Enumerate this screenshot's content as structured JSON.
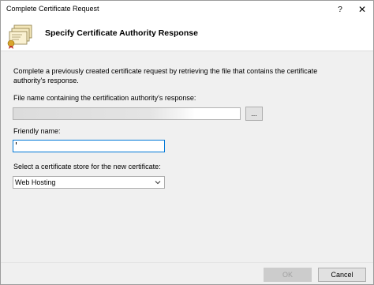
{
  "window": {
    "title": "Complete Certificate Request",
    "help_glyph": "?",
    "close_glyph": "✕"
  },
  "header": {
    "title": "Specify Certificate Authority Response",
    "icon": "certificate-stack-icon"
  },
  "description": "Complete a previously created certificate request by retrieving the file that contains the certificate authority's response.",
  "file_field": {
    "label": "File name containing the certification authority's response:",
    "value": "",
    "browse_label": "..."
  },
  "friendly_name": {
    "label": "Friendly name:",
    "value": ""
  },
  "store": {
    "label": "Select a certificate store for the new certificate:",
    "selected": "Web Hosting"
  },
  "footer": {
    "ok_label": "OK",
    "cancel_label": "Cancel"
  }
}
